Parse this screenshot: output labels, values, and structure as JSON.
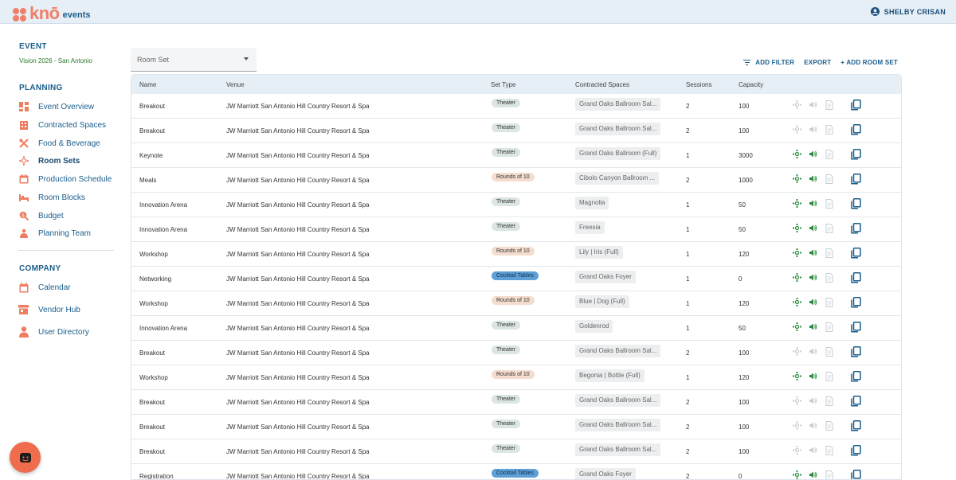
{
  "brand": {
    "logo_word": "knō",
    "logo_sub": "events",
    "accent": "#f08068"
  },
  "user": {
    "name": "SHELBY CRISAN"
  },
  "sidebar": {
    "event_heading": "EVENT",
    "event_name": "Vision 2026 - San Antonio",
    "planning_heading": "PLANNING",
    "planning_items": [
      {
        "label": "Event Overview",
        "icon": "dashboard-icon"
      },
      {
        "label": "Contracted Spaces",
        "icon": "building-icon"
      },
      {
        "label": "Food & Beverage",
        "icon": "utensils-icon"
      },
      {
        "label": "Room Sets",
        "icon": "table-setup-icon"
      },
      {
        "label": "Production Schedule",
        "icon": "calendar-clock-icon"
      },
      {
        "label": "Room Blocks",
        "icon": "bed-icon"
      },
      {
        "label": "Budget",
        "icon": "budget-icon"
      },
      {
        "label": "Planning Team",
        "icon": "team-icon"
      }
    ],
    "company_heading": "COMPANY",
    "company_items": [
      {
        "label": "Calendar",
        "icon": "calendar-icon"
      },
      {
        "label": "Vendor Hub",
        "icon": "store-icon"
      },
      {
        "label": "User Directory",
        "icon": "person-icon"
      }
    ]
  },
  "toolbar": {
    "select_label": "Room Set",
    "add_filter": "ADD FILTER",
    "export": "EXPORT",
    "add_room_set": "+ ADD ROOM SET"
  },
  "table": {
    "columns": [
      "Name",
      "Venue",
      "Set Type",
      "Contracted Spaces",
      "Sessions",
      "Capacity"
    ],
    "rows": [
      {
        "name": "Breakout",
        "venue": "JW Marriott San Antonio Hill Country Resort & Spa",
        "set_type": "Theater",
        "space": "Grand Oaks Ballroom Sal...",
        "sessions": "2",
        "capacity": "100",
        "active": false
      },
      {
        "name": "Breakout",
        "venue": "JW Marriott San Antonio Hill Country Resort & Spa",
        "set_type": "Theater",
        "space": "Grand Oaks Ballroom Sal...",
        "sessions": "2",
        "capacity": "100",
        "active": false
      },
      {
        "name": "Keynote",
        "venue": "JW Marriott San Antonio Hill Country Resort & Spa",
        "set_type": "Theater",
        "space": "Grand Oaks Ballroom (Full)",
        "sessions": "1",
        "capacity": "3000",
        "active": true
      },
      {
        "name": "Meals",
        "venue": "JW Marriott San Antonio Hill Country Resort & Spa",
        "set_type": "Rounds of 10",
        "space": "Cibolo Canyon Ballroom ...",
        "sessions": "2",
        "capacity": "1000",
        "active": true
      },
      {
        "name": "Innovation Arena",
        "venue": "JW Marriott San Antonio Hill Country Resort & Spa",
        "set_type": "Theater",
        "space": "Magnolia",
        "sessions": "1",
        "capacity": "50",
        "active": true
      },
      {
        "name": "Innovation Arena",
        "venue": "JW Marriott San Antonio Hill Country Resort & Spa",
        "set_type": "Theater",
        "space": "Freesia",
        "sessions": "1",
        "capacity": "50",
        "active": true
      },
      {
        "name": "Workshop",
        "venue": "JW Marriott San Antonio Hill Country Resort & Spa",
        "set_type": "Rounds of 10",
        "space": "Lily | Iris (Full)",
        "sessions": "1",
        "capacity": "120",
        "active": true
      },
      {
        "name": "Networking",
        "venue": "JW Marriott San Antonio Hill Country Resort & Spa",
        "set_type": "Cocktail Tables",
        "space": "Grand Oaks Foyer",
        "sessions": "1",
        "capacity": "0",
        "active": true
      },
      {
        "name": "Workshop",
        "venue": "JW Marriott San Antonio Hill Country Resort & Spa",
        "set_type": "Rounds of 10",
        "space": "Blue | Dog (Full)",
        "sessions": "1",
        "capacity": "120",
        "active": true
      },
      {
        "name": "Innovation Arena",
        "venue": "JW Marriott San Antonio Hill Country Resort & Spa",
        "set_type": "Theater",
        "space": "Goldenrod",
        "sessions": "1",
        "capacity": "50",
        "active": true
      },
      {
        "name": "Breakout",
        "venue": "JW Marriott San Antonio Hill Country Resort & Spa",
        "set_type": "Theater",
        "space": "Grand Oaks Ballroom Sal...",
        "sessions": "2",
        "capacity": "100",
        "active": false
      },
      {
        "name": "Workshop",
        "venue": "JW Marriott San Antonio Hill Country Resort & Spa",
        "set_type": "Rounds of 10",
        "space": "Begonia | Bottle (Full)",
        "sessions": "1",
        "capacity": "120",
        "active": true
      },
      {
        "name": "Breakout",
        "venue": "JW Marriott San Antonio Hill Country Resort & Spa",
        "set_type": "Theater",
        "space": "Grand Oaks Ballroom Sal...",
        "sessions": "2",
        "capacity": "100",
        "active": false
      },
      {
        "name": "Breakout",
        "venue": "JW Marriott San Antonio Hill Country Resort & Spa",
        "set_type": "Theater",
        "space": "Grand Oaks Ballroom Sal...",
        "sessions": "2",
        "capacity": "100",
        "active": false
      },
      {
        "name": "Breakout",
        "venue": "JW Marriott San Antonio Hill Country Resort & Spa",
        "set_type": "Theater",
        "space": "Grand Oaks Ballroom Sal...",
        "sessions": "2",
        "capacity": "100",
        "active": false
      },
      {
        "name": "Registration",
        "venue": "JW Marriott San Antonio Hill Country Resort & Spa",
        "set_type": "Cocktail Tables",
        "space": "Grand Oaks Foyer",
        "sessions": "2",
        "capacity": "0",
        "active": true
      }
    ]
  },
  "colors": {
    "active_green": "#2a8a3e",
    "inactive_gray": "#c7cdd2",
    "link_blue": "#1b5e8c"
  }
}
